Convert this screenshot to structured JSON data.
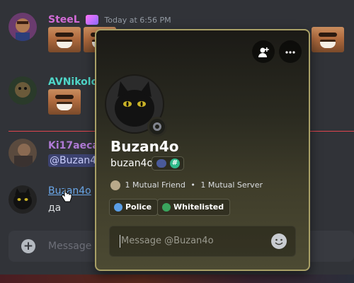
{
  "messages": {
    "steel": {
      "username": "SteeL",
      "timestamp": "Today at 6:56 PM",
      "username_color": "#d16bd6"
    },
    "avnikolov": {
      "username": "AVNikolov",
      "username_color": "#4fd6c8"
    },
    "ki17aeca": {
      "username": "Ki17aeca",
      "username_color": "#b07ad6",
      "mention": "@Buzan4"
    },
    "buzan": {
      "username": "Buzan4o",
      "username_color": "#6aa7e8",
      "text": "да"
    }
  },
  "chat_input": {
    "placeholder": "Message #"
  },
  "profile": {
    "display_name": "Buzan4o",
    "handle": "buzan4o",
    "mutual_friends": "1 Mutual Friend",
    "mutual_servers": "1 Mutual Server",
    "separator": "•",
    "roles": [
      {
        "label": "Police",
        "color": "#5a9ee6"
      },
      {
        "label": "Whitelisted",
        "color": "#3aa55d"
      }
    ],
    "message_placeholder": "Message @Buzan4o",
    "border_color": "#a9a066"
  },
  "icons": {
    "add_friend": "add-friend-icon",
    "more": "more-options-icon",
    "emoji": "emoji-icon",
    "plus": "plus-icon"
  }
}
